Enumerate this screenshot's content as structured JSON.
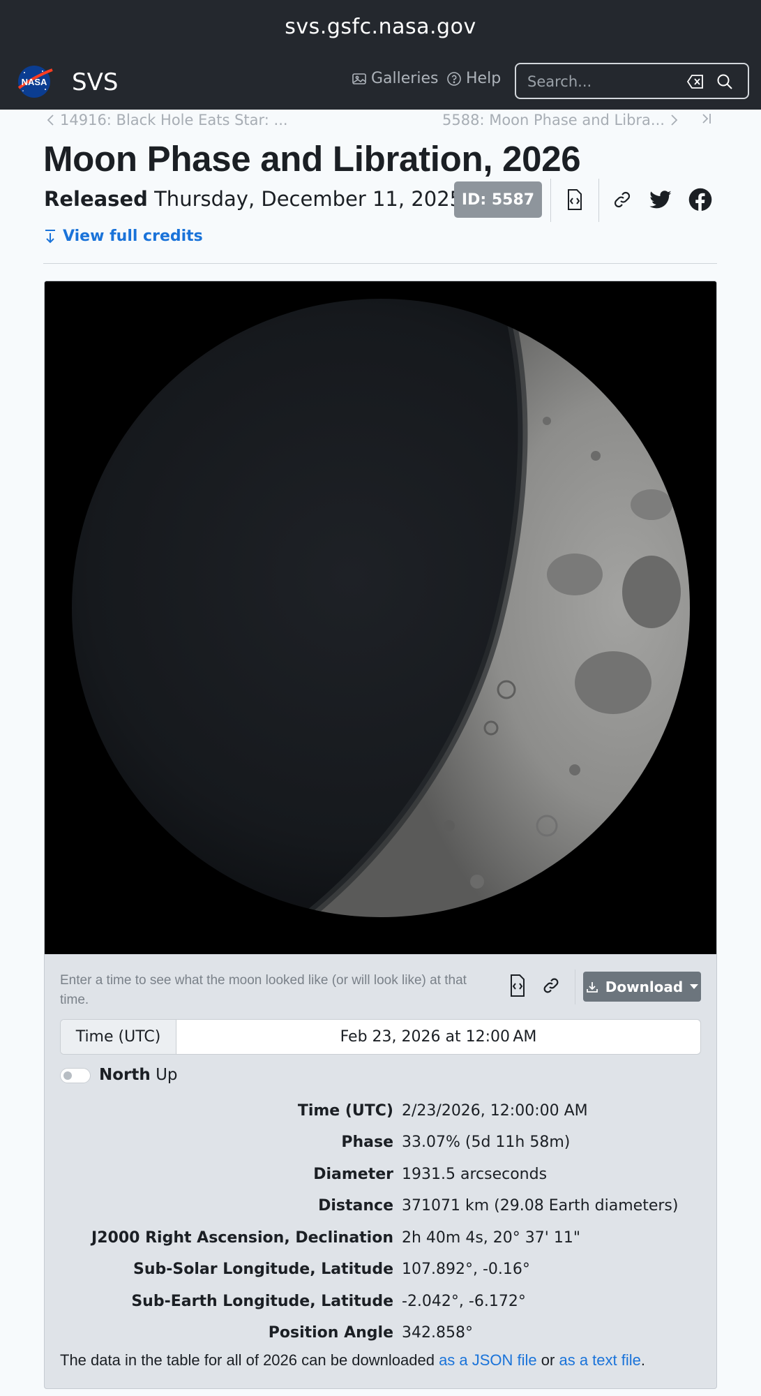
{
  "browser": {
    "url": "svs.gsfc.nasa.gov"
  },
  "navbar": {
    "logo_text": "NASA",
    "site_name": "SVS",
    "galleries_label": "Galleries",
    "help_label": "Help",
    "search_placeholder": "Search...",
    "icons": [
      "gallery-icon",
      "help-circle-icon",
      "clear-search-icon",
      "search-icon"
    ]
  },
  "pager": {
    "prev_label": "14916: Black Hole Eats Star: ...",
    "next_label": "5588: Moon Phase and Libra..."
  },
  "page": {
    "title": "Moon Phase and Libration, 2026",
    "released_label": "Released",
    "released_date": "Thursday, December 11, 2025",
    "id_badge": "ID: 5587",
    "credits_link": "View full credits",
    "share_icons": [
      "embed-code-icon",
      "link-icon",
      "twitter-icon",
      "facebook-icon"
    ]
  },
  "viewer": {
    "hint": "Enter a time to see what the moon looked like (or will look like) at that time.",
    "download_label": "Download",
    "time_label": "Time (UTC)",
    "time_value": "Feb 23, 2026 at 12:00 AM",
    "north_bold": "North",
    "north_rest": " Up"
  },
  "moon_data": [
    {
      "key": "Time (UTC)",
      "value": "2/23/2026, 12:00:00 AM"
    },
    {
      "key": "Phase",
      "value": "33.07% (5d 11h 58m)"
    },
    {
      "key": "Diameter",
      "value": "1931.5 arcseconds"
    },
    {
      "key": "Distance",
      "value": "371071 km (29.08 Earth diameters)"
    },
    {
      "key": "J2000 Right Ascension, Declination",
      "value": "2h 40m 4s, 20° 37' 11\""
    },
    {
      "key": "Sub-Solar Longitude, Latitude",
      "value": "107.892°, -0.16°"
    },
    {
      "key": "Sub-Earth Longitude, Latitude",
      "value": "-2.042°, -6.172°"
    },
    {
      "key": "Position Angle",
      "value": "342.858°"
    }
  ],
  "footer": {
    "prefix": "The data in the table for all of 2026 can be downloaded ",
    "json_link": "as a JSON file",
    "middle": " or ",
    "text_link": "as a text file",
    "suffix": "."
  },
  "colors": {
    "navbar": "#24282e",
    "link": "#1a73d9",
    "badge": "#8e959c",
    "download_button": "#6c757d"
  }
}
